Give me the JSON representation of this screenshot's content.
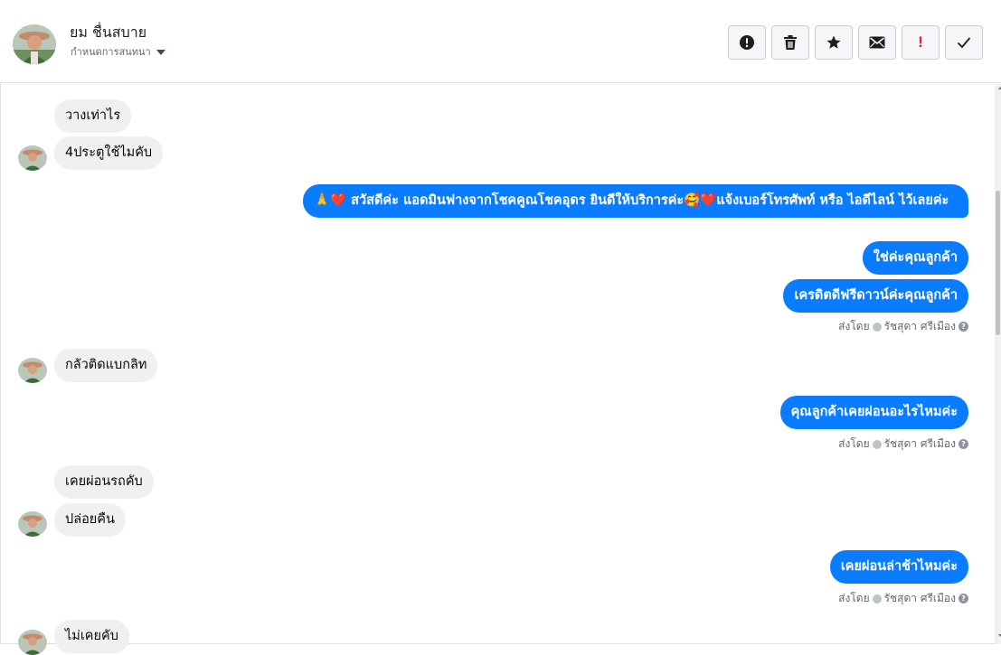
{
  "header": {
    "contact_name": "ยม ชื่นสบาย",
    "conversation_setting": "กำหนดการสนทนา",
    "icons": [
      "alert-circle-icon",
      "trash-icon",
      "star-icon",
      "envelope-icon",
      "exclamation-icon",
      "checkmark-icon"
    ]
  },
  "colors": {
    "outgoing_bubble": "#0a7cff",
    "incoming_bubble": "#f0f0f0",
    "flag_red": "#e41e3f"
  },
  "messages": {
    "m1": "วางเท่าไร",
    "m2": "4ประตูใช้ไมคับ",
    "m3": "🙏❤️ สวัสดีค่ะ แอดมินฟางจากโชคคูณโชคอุดร ยินดีให้บริการค่ะ🥰❤️แจ้งเบอร์โทรศัพท์ หรือ ไอดีไลน์  ไว้เลยค่ะ",
    "m4": "ใช่ค่ะคุณลูกค้า",
    "m5": "เครดิตดีฟรีดาวน์ค่ะคุณลูกค้า",
    "m6": "กลัวติดแบกลิท",
    "m7": "คุณลูกค้าเคยผ่อนอะไรไหมค่ะ",
    "m8": "เคยผ่อนรถคับ",
    "m9": "ปล่อยคืน",
    "m10": "เคยผ่อนล่าช้าไหมค่ะ",
    "m11": "ไม่เคยคับ"
  },
  "sent_by": {
    "prefix": "ส่งโดย",
    "agent": "รัชสุดา ศรีเมือง"
  }
}
